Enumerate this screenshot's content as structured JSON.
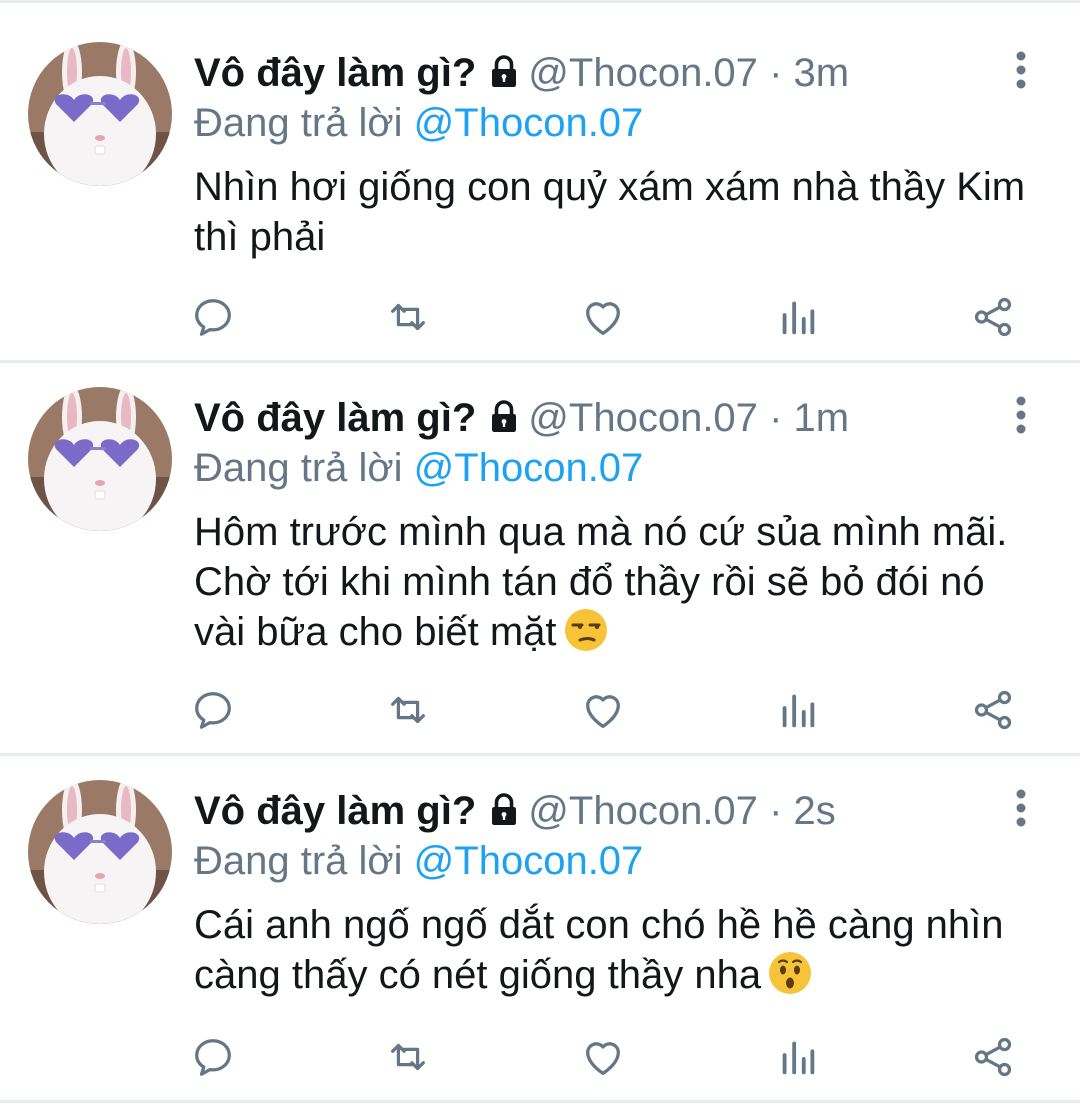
{
  "tweets": [
    {
      "name": "Vô đây làm gì?",
      "handle": "@Thocon.07",
      "separator": "·",
      "time": "3m",
      "reply_prefix": "Đang trả lời",
      "reply_to": "@Thocon.07",
      "text": "Nhìn hơi giống con quỷ xám xám nhà thầy Kim thì phải",
      "emoji": ""
    },
    {
      "name": "Vô đây làm gì?",
      "handle": "@Thocon.07",
      "separator": "·",
      "time": "1m",
      "reply_prefix": "Đang trả lời",
      "reply_to": "@Thocon.07",
      "text": "Hôm trước mình qua mà nó cứ sủa mình mãi. Chờ tới khi mình tán đổ thầy rồi sẽ bỏ đói nó vài bữa cho biết mặt",
      "emoji": "unamused-face"
    },
    {
      "name": "Vô đây làm gì?",
      "handle": "@Thocon.07",
      "separator": "·",
      "time": "2s",
      "reply_prefix": "Đang trả lời",
      "reply_to": "@Thocon.07",
      "text": "Cái anh ngố ngố dắt con chó hề hề càng nhìn càng thấy có nét giống thầy nha",
      "emoji": "hushed-face"
    }
  ],
  "icons": {
    "avatar": "bunny-with-heart-sunglasses",
    "lock": "lock-icon",
    "more": "vertical-dots-icon",
    "actions": [
      "reply-icon",
      "retweet-icon",
      "like-icon",
      "analytics-icon",
      "share-icon"
    ]
  },
  "colors": {
    "link": "#1da1f2",
    "secondary_text": "#657786",
    "icon": "#657786",
    "divider": "#e6ecf0"
  }
}
